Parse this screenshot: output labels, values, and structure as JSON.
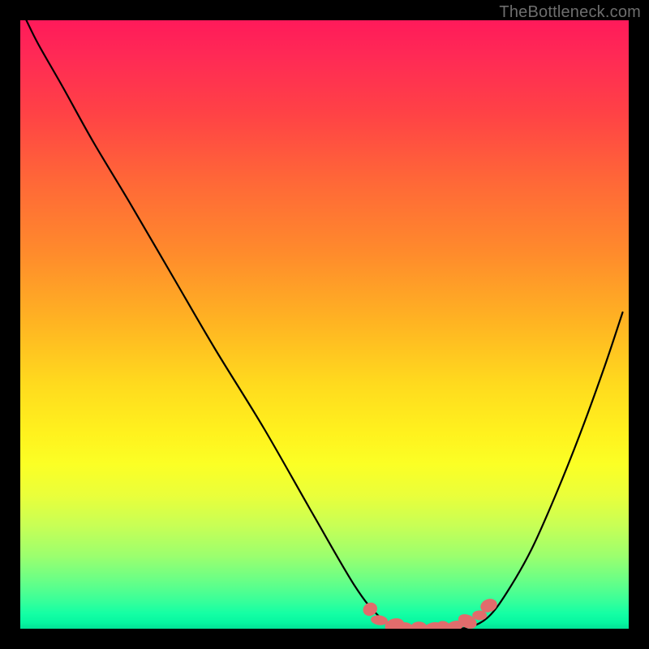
{
  "watermark": "TheBottleneck.com",
  "colors": {
    "page_bg": "#000000",
    "curve_stroke": "#000000",
    "marker_fill": "#e16c6c",
    "gradient_top": "#ff1a5a",
    "gradient_bottom": "#02e196"
  },
  "chart_data": {
    "type": "line",
    "title": "",
    "xlabel": "",
    "ylabel": "",
    "xlim": [
      0,
      100
    ],
    "ylim": [
      0,
      100
    ],
    "grid": false,
    "legend": false,
    "series": [
      {
        "name": "curve",
        "x": [
          1,
          3,
          7,
          12,
          18,
          25,
          32,
          40,
          48,
          55,
          59,
          62,
          65,
          68,
          71,
          74,
          77,
          80,
          84,
          88,
          92,
          96,
          99
        ],
        "y": [
          100,
          96,
          89,
          80,
          70,
          58,
          46,
          33,
          19,
          7,
          2,
          0.3,
          0,
          0,
          0,
          0.3,
          2,
          6,
          13,
          22,
          32,
          43,
          52
        ]
      }
    ],
    "markers": {
      "name": "bottom-cluster",
      "x": [
        57.5,
        59.0,
        61.5,
        63.5,
        65.5,
        67.5,
        69.5,
        71.5,
        73.5,
        75.5,
        77.0
      ],
      "y": [
        3.2,
        1.4,
        0.6,
        0.2,
        0.1,
        0.1,
        0.2,
        0.5,
        1.2,
        2.2,
        3.8
      ]
    }
  }
}
